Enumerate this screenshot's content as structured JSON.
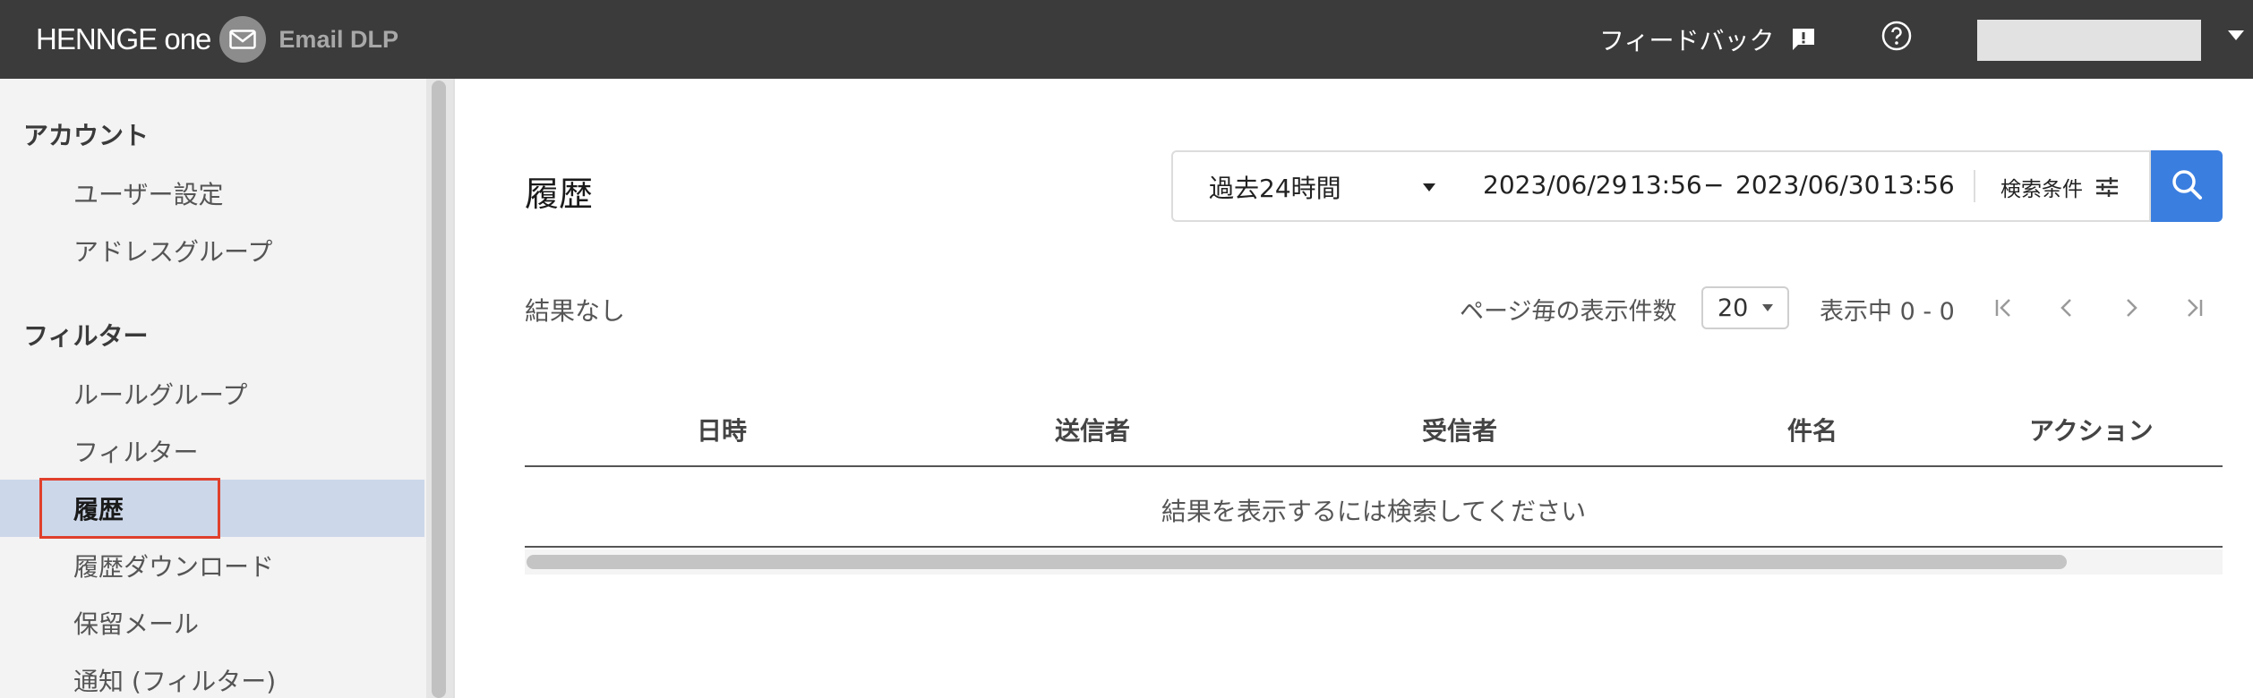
{
  "header": {
    "brand": "HENNGE one",
    "product": "Email DLP",
    "mail_icon": "envelope-icon",
    "feedback_label": "フィードバック",
    "feedback_icon": "feedback-icon",
    "help_icon": "help-circle-icon"
  },
  "sidebar": {
    "sections": [
      {
        "title": "アカウント",
        "items": [
          "ユーザー設定",
          "アドレスグループ"
        ]
      },
      {
        "title": "フィルター",
        "items": [
          "ルールグループ",
          "フィルター",
          "履歴",
          "履歴ダウンロード",
          "保留メール",
          "通知 (フィルター)"
        ]
      }
    ],
    "active_item": "履歴"
  },
  "main": {
    "title": "履歴",
    "search": {
      "range_label": "過去24時間",
      "from_date": "2023/06/29",
      "from_time": "13:56",
      "separator": "−",
      "to_date": "2023/06/30",
      "to_time": "13:56",
      "conditions_label": "検索条件",
      "conditions_icon": "sliders-icon",
      "search_icon": "search-icon"
    },
    "results_summary": "結果なし",
    "per_page_label": "ページ毎の表示件数",
    "per_page_value": "20",
    "showing": "表示中 0 - 0",
    "table": {
      "columns": [
        "日時",
        "送信者",
        "受信者",
        "件名",
        "アクション"
      ],
      "empty_message": "結果を表示するには検索してください"
    }
  },
  "colors": {
    "topbar": "#3b3b3b",
    "sidebar": "#f3f3f3",
    "active_item": "#ccd7ea",
    "highlight_outline": "#e0402c",
    "search_button": "#3a7ee0"
  }
}
